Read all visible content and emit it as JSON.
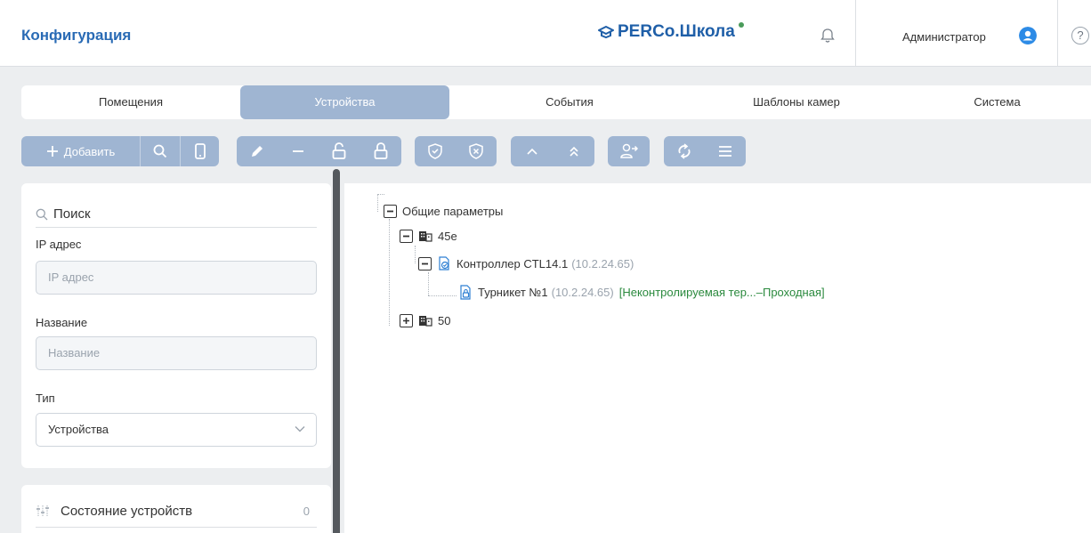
{
  "header": {
    "title": "Конфигурация",
    "logo_text": "PERCo.Школа",
    "user_name": "Администратор",
    "help_symbol": "?"
  },
  "tabs": [
    {
      "label": "Помещения",
      "active": false
    },
    {
      "label": "Устройства",
      "active": true
    },
    {
      "label": "События",
      "active": false
    },
    {
      "label": "Шаблоны камер",
      "active": false
    },
    {
      "label": "Система",
      "active": false
    }
  ],
  "toolbar": {
    "add_label": "Добавить"
  },
  "search": {
    "title": "Поиск",
    "ip_label": "IP адрес",
    "ip_placeholder": "IP адрес",
    "name_label": "Название",
    "name_placeholder": "Название",
    "type_label": "Тип",
    "type_value": "Устройства"
  },
  "device_state": {
    "label": "Состояние устройств",
    "count": "0"
  },
  "tree": {
    "root": "Общие параметры",
    "building1": "45е",
    "controller_name": "Контроллер CTL14.1",
    "controller_ip": "(10.2.24.65)",
    "turnstile_name": "Турникет №1",
    "turnstile_ip": "(10.2.24.65)",
    "turnstile_zone": "[Неконтролируемая тер...–Проходная]",
    "building2": "50"
  },
  "colors": {
    "accent": "#9fb5d2",
    "title_blue": "#2a6bb5",
    "green_text": "#2b8a3e",
    "status_dot": "#4a9b5a",
    "avatar": "#2d8be6"
  }
}
